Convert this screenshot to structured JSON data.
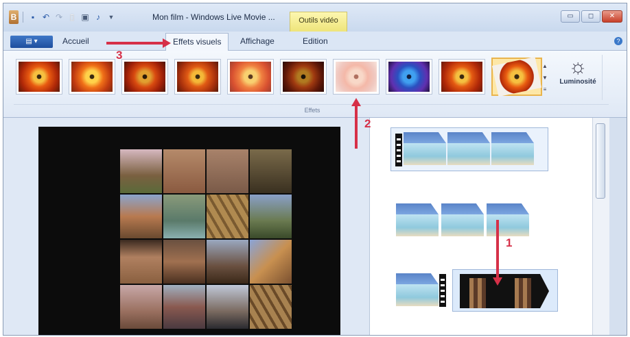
{
  "window": {
    "title": "Mon film - Windows Live Movie ...",
    "context_tab": "Outils vidéo"
  },
  "qat_icons": [
    "app-icon",
    "save-icon",
    "undo-icon",
    "redo-icon",
    "new-icon",
    "screen-icon",
    "music-icon",
    "dropdown-icon"
  ],
  "tabs": [
    {
      "label": "Accueil",
      "active": false
    },
    {
      "label": "Effets visuels",
      "active": true
    },
    {
      "label": "Affichage",
      "active": false
    },
    {
      "label": "Edition",
      "active": false
    }
  ],
  "ribbon": {
    "group_label": "Effets",
    "luminosity_label": "Luminosité",
    "effect_count": 10,
    "selected_effect_index": 9
  },
  "annotations": {
    "n1": "1",
    "n2": "2",
    "n3": "3"
  },
  "colors": {
    "annotation": "#d63048",
    "accent": "#3f77c7",
    "context": "#f1e67f"
  }
}
